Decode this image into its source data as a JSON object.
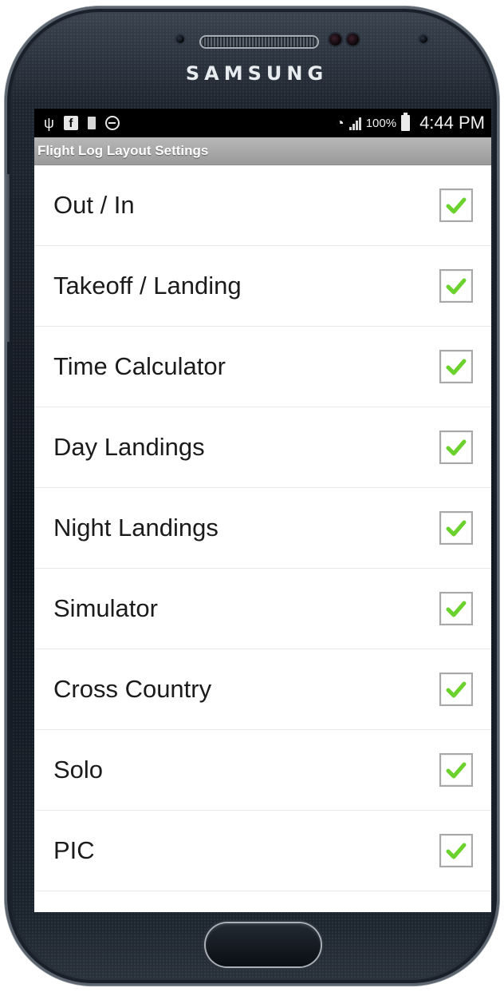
{
  "device": {
    "brand": "SAMSUNG"
  },
  "status_bar": {
    "icons_left": [
      "usb-icon",
      "facebook-icon",
      "battery-small-icon",
      "do-not-disturb-icon"
    ],
    "battery_percent": "100%",
    "time": "4:44 PM"
  },
  "app": {
    "title": "Flight Log Layout Settings"
  },
  "settings": {
    "items": [
      {
        "label": "Out / In",
        "checked": true
      },
      {
        "label": "Takeoff / Landing",
        "checked": true
      },
      {
        "label": "Time Calculator",
        "checked": true
      },
      {
        "label": "Day Landings",
        "checked": true
      },
      {
        "label": "Night Landings",
        "checked": true
      },
      {
        "label": "Simulator",
        "checked": true
      },
      {
        "label": "Cross Country",
        "checked": true
      },
      {
        "label": "Solo",
        "checked": true
      },
      {
        "label": "PIC",
        "checked": true
      }
    ]
  },
  "colors": {
    "check_green": "#6bd12c",
    "title_bar": "#a8a8a8"
  }
}
